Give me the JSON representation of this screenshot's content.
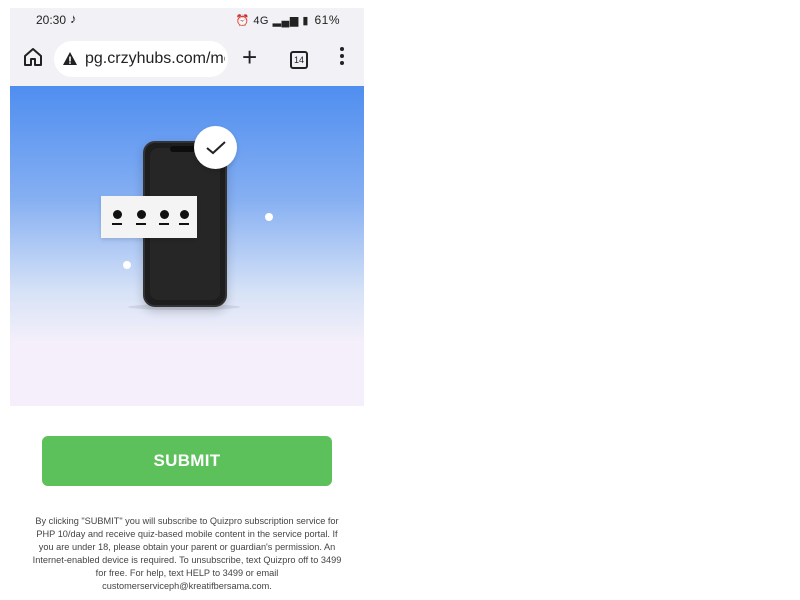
{
  "status_bar": {
    "time": "20:30",
    "app_icon": "tiktok-icon",
    "signal_indicators": "⏰ ⁴ᴳ 4G ıll",
    "battery": "61%"
  },
  "browser": {
    "url": "pg.crzyhubs.com/me",
    "tab_count": "14",
    "icons": {
      "home": "home-icon",
      "warning": "not-secure-warning-icon",
      "new_tab": "plus-icon",
      "menu": "kebab-menu-icon"
    }
  },
  "hero": {
    "gradient_top": "#4f8ef0",
    "gradient_bottom": "#f4effa",
    "pin_digits": 4
  },
  "submit": {
    "label": "SUBMIT",
    "color": "#5cc15a"
  },
  "disclaimer": {
    "text": "By clicking \"SUBMIT\" you will subscribe to Quizpro subscription service for PHP 10/day and receive quiz-based mobile content in the service portal. If you are under 18, please obtain your parent or guardian's permission. An Internet-enabled device is required. To unsubscribe, text Quizpro off to 3499 for free. For help, text HELP to 3499 or email customerserviceph@kreatifbersama.com."
  }
}
